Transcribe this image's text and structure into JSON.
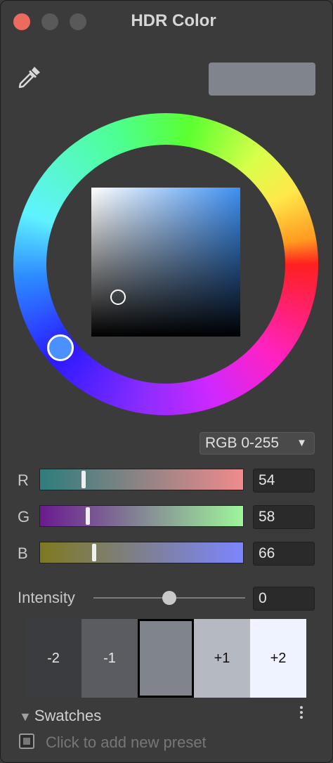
{
  "window": {
    "title": "HDR Color",
    "controls": [
      "close",
      "minimize",
      "maximize"
    ]
  },
  "toolbar": {
    "eyedropper_icon": "eyedropper-icon",
    "preview_color": "#80848c"
  },
  "color_wheel": {
    "hue_handle_color": "#4a90ff",
    "sv_square_hue_color": "#3e8ff2"
  },
  "mode_select": {
    "selected": "RGB 0-255"
  },
  "channels": [
    {
      "label": "R",
      "value": "54",
      "fraction": 0.21
    },
    {
      "label": "G",
      "value": "58",
      "fraction": 0.23
    },
    {
      "label": "B",
      "value": "66",
      "fraction": 0.26
    }
  ],
  "intensity": {
    "label": "Intensity",
    "value": "0",
    "fraction": 0.5
  },
  "exposure_swatches": [
    {
      "label": "-2",
      "color": "#3b3c3f",
      "text_color": "#e8e8e8"
    },
    {
      "label": "-1",
      "color": "#5a5c61",
      "text_color": "#e8e8e8"
    },
    {
      "label": "",
      "color": "#80848c",
      "selected": true
    },
    {
      "label": "+1",
      "color": "#b5b9c2",
      "text_color": "#111111"
    },
    {
      "label": "+2",
      "color": "#eef3ff",
      "text_color": "#111111"
    }
  ],
  "swatches": {
    "header": "Swatches",
    "add_preset_text": "Click to add new preset"
  }
}
